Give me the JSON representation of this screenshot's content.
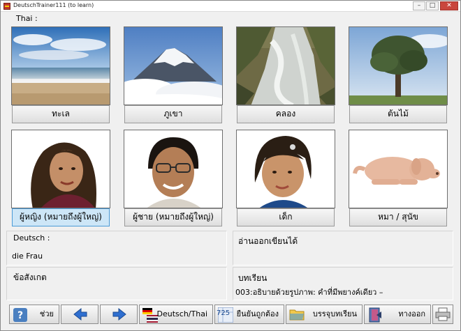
{
  "window": {
    "title": "DeutschTrainer111 (to learn)",
    "close_glyph": "✕",
    "min_glyph": "–",
    "max_glyph": "□"
  },
  "language_label": "Thai :",
  "tiles": [
    {
      "caption": "ทะเล",
      "image": "sea-photo"
    },
    {
      "caption": "ภูเขา",
      "image": "mountain-photo"
    },
    {
      "caption": "คลอง",
      "image": "canal-photo"
    },
    {
      "caption": "ต้นไม้",
      "image": "tree-photo"
    },
    {
      "caption": "ผู้หญิง  (หมายถึงผู้ใหญ่)",
      "image": "woman-photo",
      "selected": true
    },
    {
      "caption": "ผู้ชาย  (หมายถึงผู้ใหญ่)",
      "image": "man-photo"
    },
    {
      "caption": "เด็ก",
      "image": "child-photo"
    },
    {
      "caption": "หมา  /  สุนัข",
      "image": "dog-photo"
    }
  ],
  "panels": {
    "deutsch_label": "Deutsch :",
    "deutsch_value": "die Frau",
    "reading_label": "อ่านออกเขียนได้",
    "notes_label": "ข้อสังเกต",
    "lesson_label": "บทเรียน",
    "lesson_value": "003:อธิบายด้วยรูปภาพ:  คำที่มีพยางค์เดียว    –"
  },
  "toolbar": {
    "help_label": "ช่วย",
    "language_pair_label": "Deutsch/Thai",
    "confirm_label": "ยืนยันถูกต้อง",
    "confirm_count": "725",
    "contents_label": "บรรจุบทเรียน",
    "exit_label": "ทางออก"
  },
  "colors": {
    "accent": "#4a9ad6",
    "selected_caption": "#cde6f7",
    "close_button": "#c9463d"
  }
}
